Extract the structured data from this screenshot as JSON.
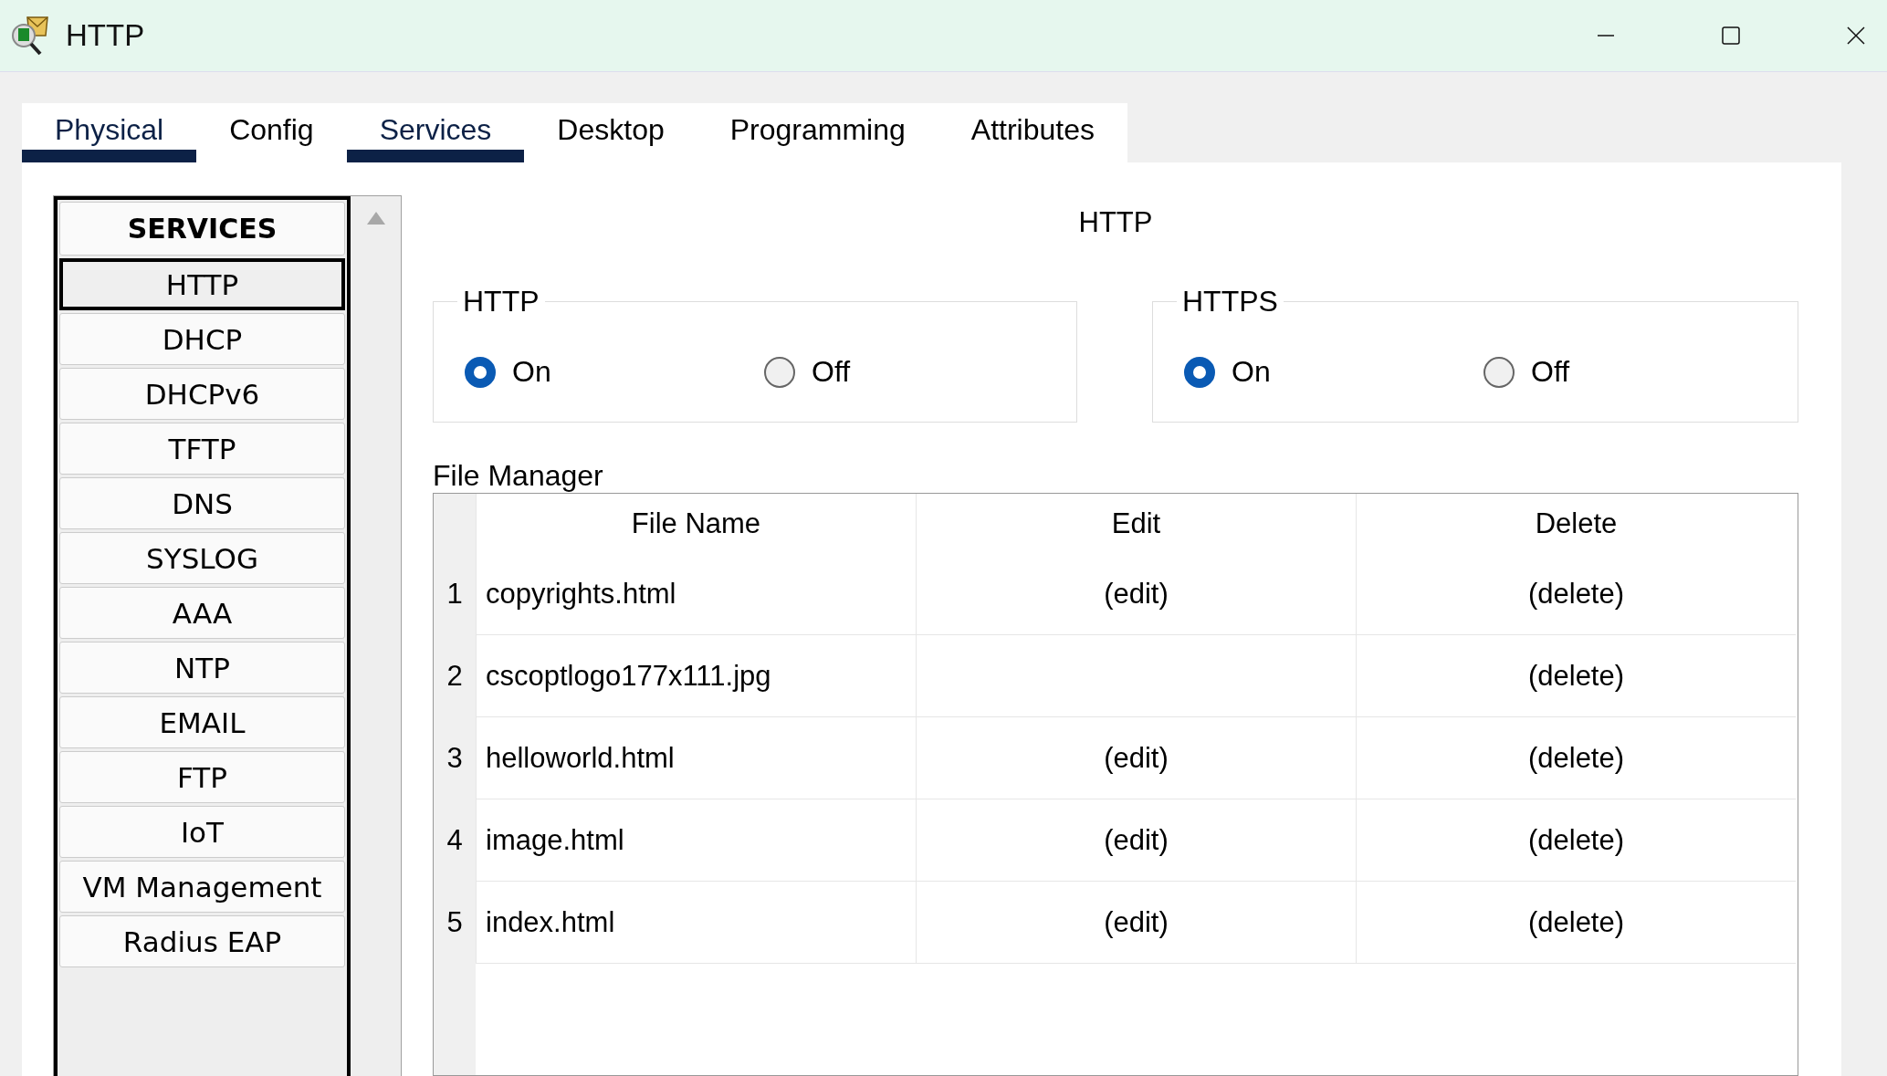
{
  "window": {
    "title": "HTTP"
  },
  "tabs": [
    {
      "label": "Physical",
      "selected": true
    },
    {
      "label": "Config",
      "selected": false
    },
    {
      "label": "Services",
      "selected": true
    },
    {
      "label": "Desktop",
      "selected": false
    },
    {
      "label": "Programming",
      "selected": false
    },
    {
      "label": "Attributes",
      "selected": false
    }
  ],
  "sidebar": {
    "title": "SERVICES",
    "items": [
      {
        "label": "HTTP",
        "selected": true
      },
      {
        "label": "DHCP",
        "selected": false
      },
      {
        "label": "DHCPv6",
        "selected": false
      },
      {
        "label": "TFTP",
        "selected": false
      },
      {
        "label": "DNS",
        "selected": false
      },
      {
        "label": "SYSLOG",
        "selected": false
      },
      {
        "label": "AAA",
        "selected": false
      },
      {
        "label": "NTP",
        "selected": false
      },
      {
        "label": "EMAIL",
        "selected": false
      },
      {
        "label": "FTP",
        "selected": false
      },
      {
        "label": "IoT",
        "selected": false
      },
      {
        "label": "VM Management",
        "selected": false
      },
      {
        "label": "Radius EAP",
        "selected": false
      }
    ]
  },
  "content": {
    "title": "HTTP",
    "groups": [
      {
        "title": "HTTP",
        "options": [
          {
            "label": "On",
            "selected": true
          },
          {
            "label": "Off",
            "selected": false
          }
        ]
      },
      {
        "title": "HTTPS",
        "options": [
          {
            "label": "On",
            "selected": true
          },
          {
            "label": "Off",
            "selected": false
          }
        ]
      }
    ],
    "file_manager": {
      "title": "File Manager",
      "columns": [
        "File Name",
        "Edit",
        "Delete"
      ],
      "rows": [
        {
          "number": "1",
          "file_name": "copyrights.html",
          "edit": "(edit)",
          "delete": "(delete)"
        },
        {
          "number": "2",
          "file_name": "cscoptlogo177x111.jpg",
          "delete": "(delete)"
        },
        {
          "number": "3",
          "file_name": "helloworld.html",
          "edit": "(edit)",
          "delete": "(delete)"
        },
        {
          "number": "4",
          "file_name": "image.html",
          "edit": "(edit)",
          "delete": "(delete)"
        },
        {
          "number": "5",
          "file_name": "index.html",
          "edit": "(edit)",
          "delete": "(delete)"
        }
      ]
    }
  }
}
